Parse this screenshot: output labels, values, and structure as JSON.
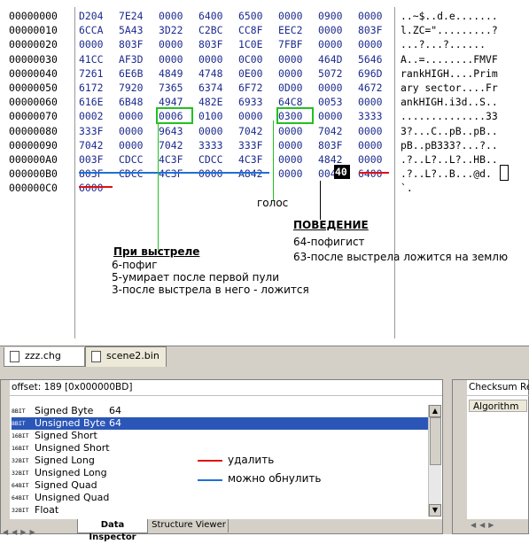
{
  "hex": {
    "offsets": [
      "00000000",
      "00000010",
      "00000020",
      "00000030",
      "00000040",
      "00000050",
      "00000060",
      "00000070",
      "00000080",
      "00000090",
      "000000A0",
      "000000B0",
      "000000C0"
    ],
    "rows": [
      [
        "D204",
        "7E24",
        "0000",
        "6400",
        "6500",
        "0000",
        "0900",
        "0000"
      ],
      [
        "6CCA",
        "5A43",
        "3D22",
        "C2BC",
        "CC8F",
        "EEC2",
        "0000",
        "803F"
      ],
      [
        "0000",
        "803F",
        "0000",
        "803F",
        "1C0E",
        "7FBF",
        "0000",
        "0000"
      ],
      [
        "41CC",
        "AF3D",
        "0000",
        "0000",
        "0C00",
        "0000",
        "464D",
        "5646"
      ],
      [
        "7261",
        "6E6B",
        "4849",
        "4748",
        "0E00",
        "0000",
        "5072",
        "696D"
      ],
      [
        "6172",
        "7920",
        "7365",
        "6374",
        "6F72",
        "0D00",
        "0000",
        "4672"
      ],
      [
        "616E",
        "6B48",
        "4947",
        "482E",
        "6933",
        "64C8",
        "0053",
        "0000"
      ],
      [
        "0002",
        "0000",
        "0006",
        "0100",
        "0000",
        "0300",
        "0000",
        "3333"
      ],
      [
        "333F",
        "0000",
        "9643",
        "0000",
        "7042",
        "0000",
        "7042",
        "0000"
      ],
      [
        "7042",
        "0000",
        "7042",
        "3333",
        "333F",
        "0000",
        "803F",
        "0000"
      ],
      [
        "003F",
        "CDCC",
        "4C3F",
        "CDCC",
        "4C3F",
        "0000",
        "4842",
        "0000"
      ],
      [
        "803F",
        "CDCC",
        "4C3F",
        "0000",
        "A842",
        "0000",
        "0040",
        "6400"
      ],
      [
        "6000",
        "",
        "",
        "",
        "",
        "",
        "",
        ""
      ]
    ],
    "ascii": [
      "..~$..d.e.......",
      "l.ZC=\".........?",
      "...?...?......",
      "A..=........FMVF",
      "rankHIGH....Prim",
      "ary sector....Fr",
      "ankHIGH.i3d..S..",
      "..............33",
      "3?...C..pB..pB..",
      "pB..pB333?...?..",
      ".?..L?..L?..HB..",
      ".?..L?..B...@d.",
      "`."
    ]
  },
  "annotations": {
    "voice": "голос",
    "behavior_title": "ПОВЕДЕНИЕ",
    "behavior_1": "64-пофигист",
    "behavior_2": "63-после выстрела ложится на землю",
    "shot_title": "При выстреле",
    "shot_1": "6-пофиг",
    "shot_2": "5-умирает после первой пули",
    "shot_3": "3-после выстрела в него - ложится",
    "legend_delete": "удалить",
    "legend_zero": "можно обнулить",
    "colors": {
      "red": "#e01010",
      "blue": "#1f6fd6",
      "green": "#22c022",
      "highlight": "#000000"
    }
  },
  "tabs": [
    {
      "label": "zzz.chg",
      "icon": "document-icon"
    },
    {
      "label": "scene2.bin",
      "icon": "document-icon"
    }
  ],
  "inspector": {
    "offset_label": "offset: 189 [0x000000BD]",
    "rows": [
      {
        "bits": "8BIT",
        "label": "Signed Byte",
        "value": "64"
      },
      {
        "bits": "8BIT",
        "label": "Unsigned Byte",
        "value": "64"
      },
      {
        "bits": "16BIT",
        "label": "Signed Short",
        "value": ""
      },
      {
        "bits": "16BIT",
        "label": "Unsigned Short",
        "value": ""
      },
      {
        "bits": "32BIT",
        "label": "Signed Long",
        "value": ""
      },
      {
        "bits": "32BIT",
        "label": "Unsigned Long",
        "value": ""
      },
      {
        "bits": "64BIT",
        "label": "Signed Quad",
        "value": ""
      },
      {
        "bits": "64BIT",
        "label": "Unsigned Quad",
        "value": ""
      },
      {
        "bits": "32BIT",
        "label": "Float",
        "value": ""
      }
    ],
    "selected_index": 1,
    "bottom_tabs": [
      "Data Inspector",
      "Structure Viewer"
    ]
  },
  "checksum": {
    "title": "Checksum Res",
    "column": "Algorithm"
  }
}
